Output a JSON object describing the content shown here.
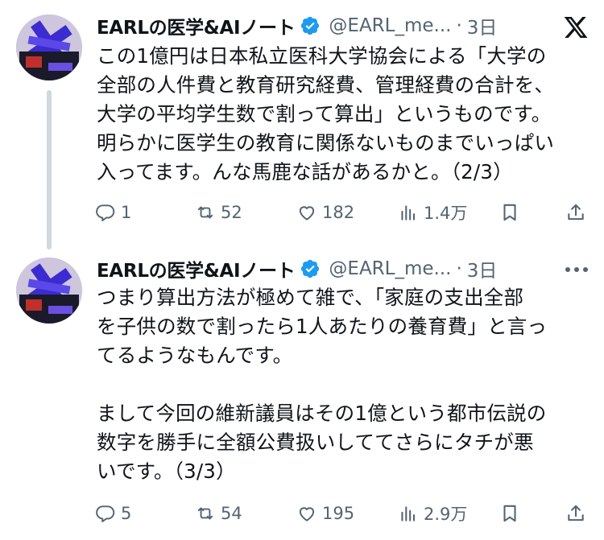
{
  "tweets": [
    {
      "author": {
        "display_name": "EARLの医学&AIノート",
        "handle": "@EARL_me...",
        "time": "3日"
      },
      "lines": [
        "この1億円は日本私立医科大学協会による「大学の",
        "全部の人件費と教育研究経費、管理経費の合計を、",
        "大学の平均学生数で割って算出」というものです。",
        "明らかに医学生の教育に関係ないものまでいっぱい",
        "入ってます。んな馬鹿な話があるかと。（2/3）"
      ],
      "stats": {
        "replies": "1",
        "retweets": "52",
        "likes": "182",
        "views": "1.4万"
      }
    },
    {
      "author": {
        "display_name": "EARLの医学&AIノート",
        "handle": "@EARL_me...",
        "time": "3日"
      },
      "lines": [
        "つまり算出方法が極めて雑で、「家庭の支出全部",
        "を子供の数で割ったら1人あたりの養育費」と言っ",
        "てるようなもんです。",
        "",
        "まして今回の維新議員はその1億という都市伝説の",
        "数字を勝手に全額公費扱いしててさらにタチが悪",
        "いです。（3/3）"
      ],
      "stats": {
        "replies": "5",
        "retweets": "54",
        "likes": "195",
        "views": "2.9万"
      }
    }
  ],
  "icons": {
    "x_logo": "x-logo-icon",
    "verified": "verified-badge-icon",
    "more": "more-icon",
    "reply": "reply-icon",
    "retweet": "retweet-icon",
    "like": "heart-icon",
    "views": "views-icon",
    "bookmark": "bookmark-icon",
    "share": "share-icon"
  },
  "colors": {
    "verified": "#1d9bf0",
    "secondary_text": "#536471",
    "thread_line": "#cfd9de"
  }
}
